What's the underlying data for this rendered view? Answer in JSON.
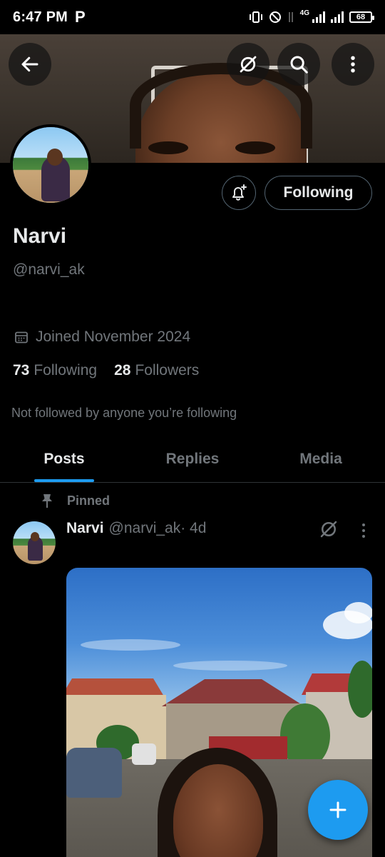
{
  "status_bar": {
    "time": "6:47 PM",
    "carrier_icon": "P",
    "network": "4G",
    "battery": "68"
  },
  "header": {
    "back_icon": "arrow-left-icon",
    "grok_icon": "grok-icon",
    "search_icon": "search-icon",
    "more_icon": "more-vertical-icon"
  },
  "profile": {
    "display_name": "Narvi",
    "handle": "@narvi_ak",
    "joined": "Joined November 2024",
    "following_count": "73",
    "following_label": "Following",
    "followers_count": "28",
    "followers_label": "Followers",
    "not_followed_text": "Not followed by anyone you’re following",
    "follow_button_label": "Following",
    "notify_icon": "bell-plus-icon"
  },
  "tabs": [
    {
      "label": "Posts",
      "active": true
    },
    {
      "label": "Replies",
      "active": false
    },
    {
      "label": "Media",
      "active": false
    }
  ],
  "pinned_post": {
    "pinned_label": "Pinned",
    "author_name": "Narvi",
    "author_handle": "@narvi_ak",
    "time_ago": " · 4d"
  },
  "fab": {
    "icon": "plus-icon"
  },
  "colors": {
    "accent": "#1d9bf0",
    "background": "#000000",
    "secondary_text": "#71767b",
    "primary_text": "#e7e9ea",
    "border": "#536471"
  }
}
